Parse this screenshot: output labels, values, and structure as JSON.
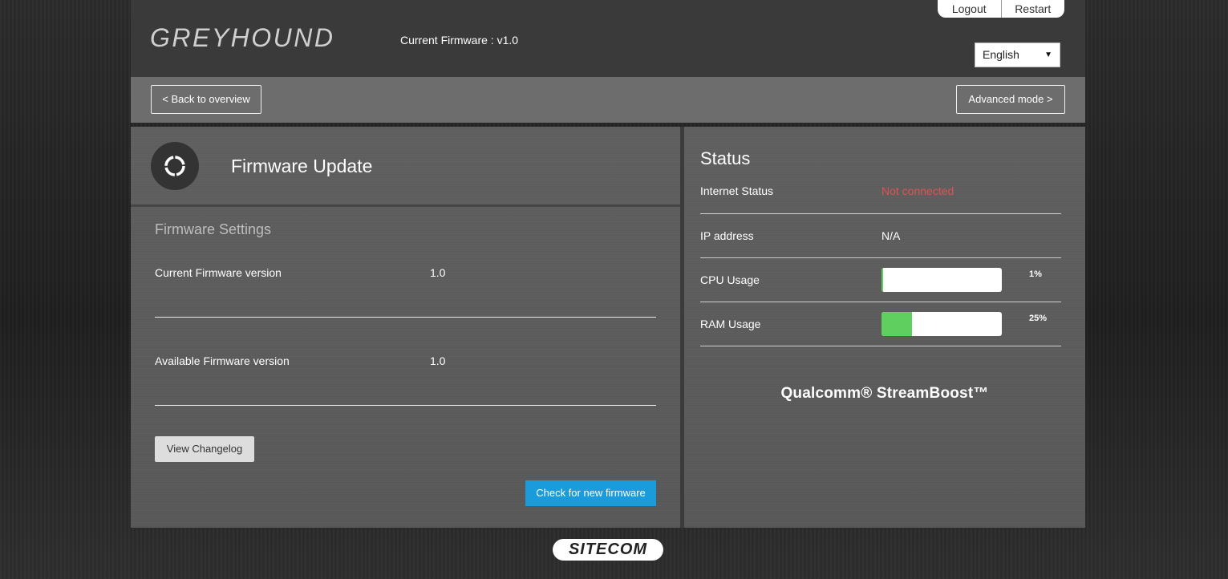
{
  "header": {
    "brand": "GREYHOUND",
    "current_firmware": "Current Firmware : v1.0",
    "logout": "Logout",
    "restart": "Restart",
    "language": "English"
  },
  "toolbar": {
    "back": "< Back to overview",
    "advanced": "Advanced mode >"
  },
  "firmware": {
    "title": "Firmware Update",
    "section_title": "Firmware Settings",
    "rows": [
      {
        "label": "Current Firmware version",
        "value": "1.0"
      },
      {
        "label": "Available Firmware version",
        "value": "1.0"
      }
    ],
    "changelog_btn": "View Changelog",
    "check_btn": "Check for new firmware"
  },
  "status": {
    "title": "Status",
    "internet_label": "Internet Status",
    "internet_value": "Not connected",
    "ip_label": "IP address",
    "ip_value": "N/A",
    "cpu_label": "CPU Usage",
    "cpu_pct": "1%",
    "cpu_value": 0.01,
    "ram_label": "RAM Usage",
    "ram_pct": "25%",
    "ram_value": 0.25,
    "brand": "Qualcomm® StreamBoost™",
    "error_color": "#e05252",
    "bar_color": "#5fcf5f"
  },
  "footer": {
    "logo": "SITECOM"
  }
}
